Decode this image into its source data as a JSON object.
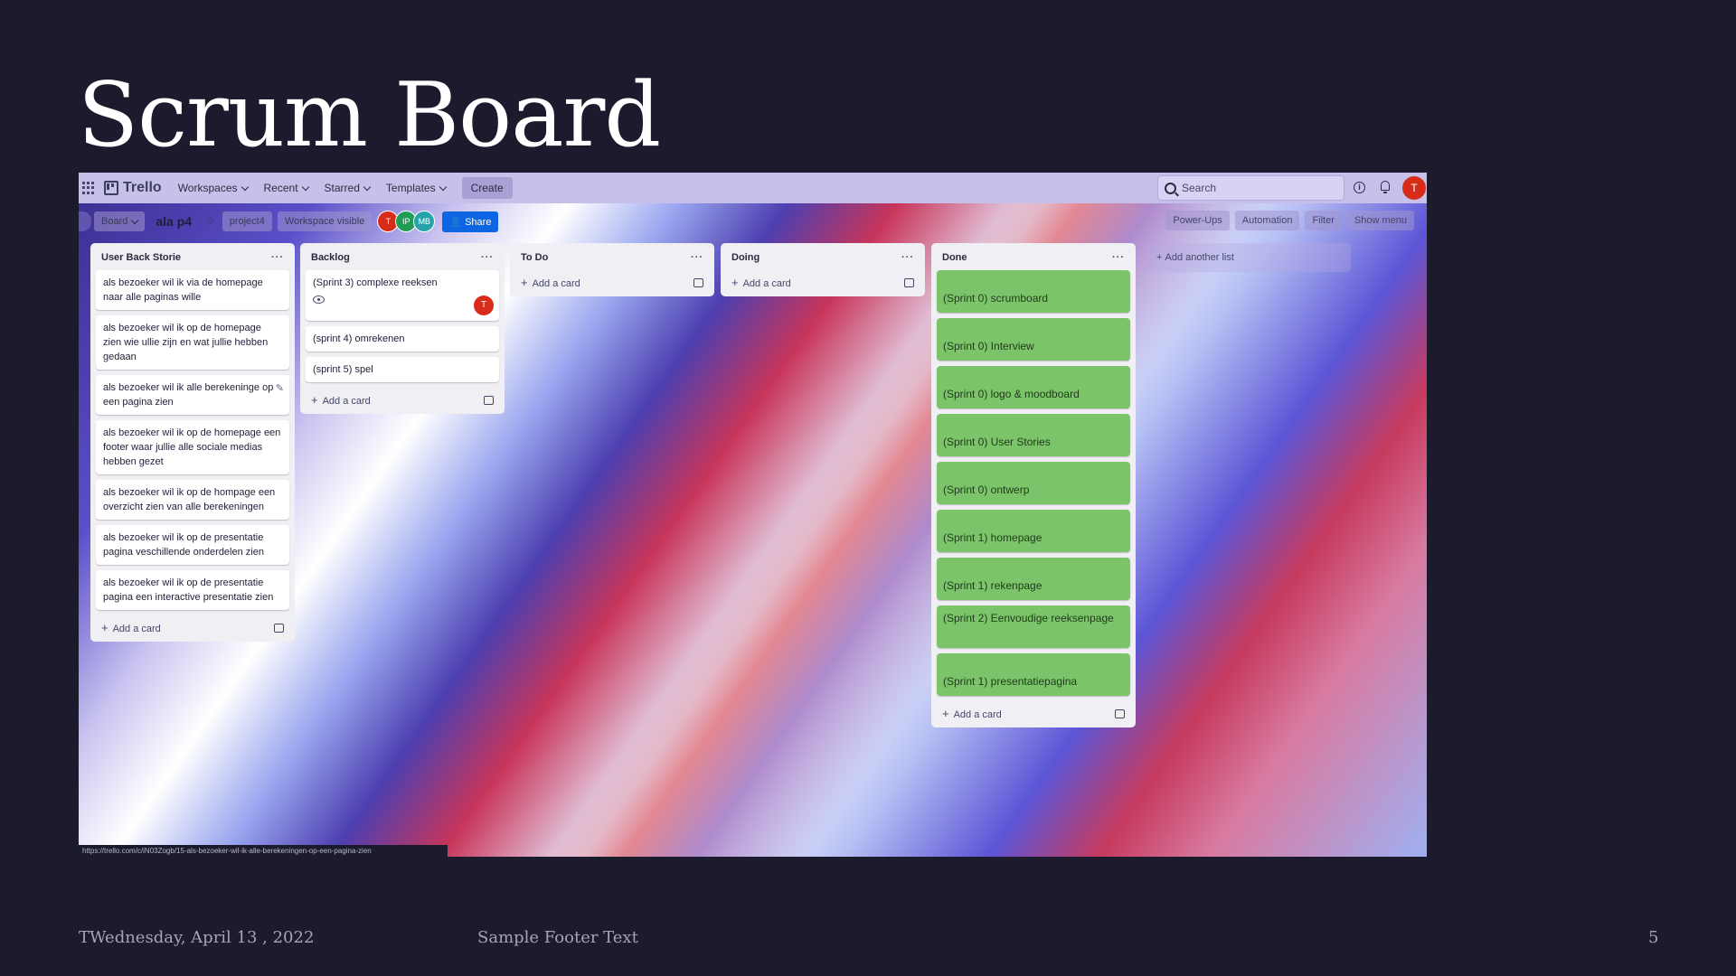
{
  "slide": {
    "title": "Scrum Board",
    "footer_date": "TWednesday, April 13 , 2022",
    "footer_text": "Sample Footer Text",
    "page_number": "5"
  },
  "topnav": {
    "logo": "Trello",
    "items": [
      "Workspaces",
      "Recent",
      "Starred",
      "Templates"
    ],
    "create": "Create",
    "search_placeholder": "Search",
    "avatar": "T"
  },
  "boardbar": {
    "view": "Board",
    "board_name": "ala p4",
    "workspace": "project4",
    "visibility": "Workspace visible",
    "members": [
      {
        "initials": "T",
        "color": "#d72c1a"
      },
      {
        "initials": "IP",
        "color": "#1f9d55"
      },
      {
        "initials": "MB",
        "color": "#26a3a8"
      }
    ],
    "share": "Share",
    "right": [
      "Power-Ups",
      "Automation",
      "Filter",
      "Show menu"
    ]
  },
  "lists": [
    {
      "title": "User Back Storie",
      "cards": [
        "als bezoeker wil ik via de homepage naar alle paginas wille",
        "als bezoeker wil ik op de homepage zien wie ullie zijn en wat jullie hebben gedaan",
        "als bezoeker wil ik alle berekeninge op een pagina zien",
        "als bezoeker wil ik op de homepage een footer waar jullie alle sociale medias hebben gezet",
        "als bezoeker wil ik op de hompage een overzicht zien van alle berekeningen",
        "als bezoeker wil ik op de presentatie pagina veschillende onderdelen zien",
        "als bezoeker wil ik op de presentatie pagina een interactive presentatie zien"
      ],
      "add": "Add a card"
    },
    {
      "title": "Backlog",
      "cards": [
        "(Sprint 3) complexe reeksen",
        "(sprint 4) omrekenen",
        "(sprint 5) spel"
      ],
      "card_avatar": "T",
      "add": "Add a card"
    },
    {
      "title": "To Do",
      "cards": [],
      "add": "Add a card"
    },
    {
      "title": "Doing",
      "cards": [],
      "add": "Add a card"
    },
    {
      "title": "Done",
      "cards": [
        "(Sprint 0) scrumboard",
        "(Sprint 0) Interview",
        "(Sprint 0) logo & moodboard",
        "(Sprint 0) User Stories",
        "(Sprint 0) ontwerp",
        "(Sprint 1) homepage",
        "(Sprint 1) rekenpage",
        "(Sprint 2) Eenvoudige reeksenpage",
        "(Sprint 1) presentatiepagina"
      ],
      "add": "Add a card"
    }
  ],
  "add_list": "Add another list",
  "status_url": "https://trello.com/c/iN03Zogb/15-als-bezoeker-wil-ik-alle-berekeningen-op-een-pagina-zien"
}
